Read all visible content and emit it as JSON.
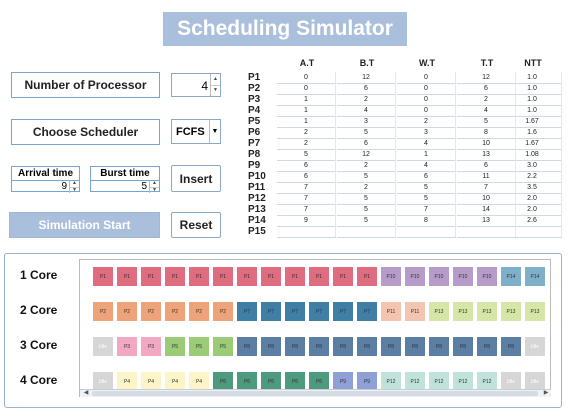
{
  "title": "Scheduling Simulator",
  "controls": {
    "num_processor_label": "Number of Processor",
    "num_processor_value": "4",
    "choose_scheduler_label": "Choose Scheduler",
    "scheduler_value": "FCFS",
    "arrival_label": "Arrival time",
    "arrival_value": "9",
    "burst_label": "Burst time",
    "burst_value": "5",
    "insert_label": "Insert",
    "start_label": "Simulation Start",
    "reset_label": "Reset"
  },
  "table": {
    "headers": [
      "A.T",
      "B.T",
      "W.T",
      "T.T",
      "NTT"
    ],
    "rows": [
      {
        "p": "P1",
        "v": [
          "0",
          "12",
          "0",
          "12",
          "1.0"
        ]
      },
      {
        "p": "P2",
        "v": [
          "0",
          "6",
          "0",
          "6",
          "1.0"
        ]
      },
      {
        "p": "P3",
        "v": [
          "1",
          "2",
          "0",
          "2",
          "1.0"
        ]
      },
      {
        "p": "P4",
        "v": [
          "1",
          "4",
          "0",
          "4",
          "1.0"
        ]
      },
      {
        "p": "P5",
        "v": [
          "1",
          "3",
          "2",
          "5",
          "1.67"
        ]
      },
      {
        "p": "P6",
        "v": [
          "2",
          "5",
          "3",
          "8",
          "1.6"
        ]
      },
      {
        "p": "P7",
        "v": [
          "2",
          "6",
          "4",
          "10",
          "1.67"
        ]
      },
      {
        "p": "P8",
        "v": [
          "5",
          "12",
          "1",
          "13",
          "1.08"
        ]
      },
      {
        "p": "P9",
        "v": [
          "6",
          "2",
          "4",
          "6",
          "3.0"
        ]
      },
      {
        "p": "P10",
        "v": [
          "6",
          "5",
          "6",
          "11",
          "2.2"
        ]
      },
      {
        "p": "P11",
        "v": [
          "7",
          "2",
          "5",
          "7",
          "3.5"
        ]
      },
      {
        "p": "P12",
        "v": [
          "7",
          "5",
          "5",
          "10",
          "2.0"
        ]
      },
      {
        "p": "P13",
        "v": [
          "7",
          "5",
          "7",
          "14",
          "2.0"
        ]
      },
      {
        "p": "P14",
        "v": [
          "9",
          "5",
          "8",
          "13",
          "2.6"
        ]
      },
      {
        "p": "P15",
        "v": [
          "",
          "",
          "",
          "",
          ""
        ]
      }
    ]
  },
  "gantt": {
    "cores": [
      {
        "label": "1 Core",
        "blocks": [
          "P1",
          "P1",
          "P1",
          "P1",
          "P1",
          "P1",
          "P1",
          "P1",
          "P1",
          "P1",
          "P1",
          "P1",
          "P10",
          "P10",
          "P10",
          "P10",
          "P10",
          "P14",
          "P14"
        ]
      },
      {
        "label": "2 Core",
        "blocks": [
          "P2",
          "P2",
          "P2",
          "P2",
          "P2",
          "P2",
          "P7",
          "P7",
          "P7",
          "P7",
          "P7",
          "P7",
          "P11",
          "P11",
          "P13",
          "P13",
          "P13",
          "P13",
          "P13"
        ]
      },
      {
        "label": "3 Core",
        "blocks": [
          "Idle",
          "P3",
          "P3",
          "P5",
          "P5",
          "P5",
          "P8",
          "P8",
          "P8",
          "P8",
          "P8",
          "P8",
          "P8",
          "P8",
          "P8",
          "P8",
          "P8",
          "P8",
          "Idle"
        ]
      },
      {
        "label": "4 Core",
        "blocks": [
          "Idle",
          "P4",
          "P4",
          "P4",
          "P4",
          "P6",
          "P6",
          "P6",
          "P6",
          "P6",
          "P9",
          "P9",
          "P12",
          "P12",
          "P12",
          "P12",
          "P12",
          "Idle",
          "Idle"
        ]
      }
    ],
    "colors": {
      "P1": "#e06c7f",
      "P2": "#eea37a",
      "P3": "#f2a7c3",
      "P4": "#fbf5c8",
      "P5": "#9ccb77",
      "P6": "#4e9a7e",
      "P7": "#3f7fa6",
      "P8": "#5b7fa3",
      "P9": "#8ea0d6",
      "P10": "#b79cc9",
      "P11": "#f3c5b0",
      "P12": "#bfe3da",
      "P13": "#d5e6a6",
      "P14": "#7fb0c9",
      "Idle": "#d6d6d6"
    }
  }
}
